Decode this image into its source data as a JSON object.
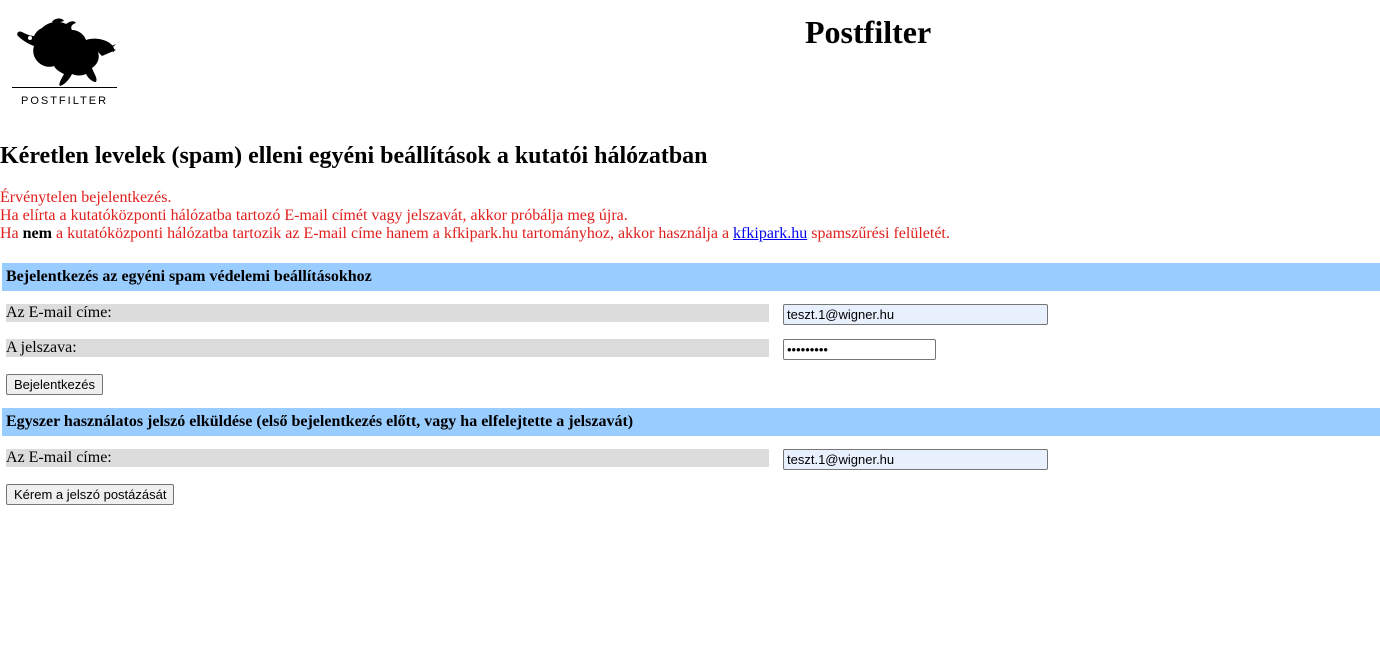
{
  "logo": {
    "text": "POSTFILTER"
  },
  "site_title": "Postfilter",
  "page_heading": "Kéretlen levelek (spam) elleni egyéni beállítások a kutatói hálózatban",
  "messages": {
    "line1": "Érvénytelen bejelentkezés.",
    "line2": "Ha elírta a kutatóközponti hálózatba tartozó E-mail címét vagy jelszavát, akkor próbálja meg újra.",
    "line3_prefix": "Ha ",
    "line3_bold": "nem",
    "line3_middle": " a kutatóközponti hálózatba tartozik az E-mail címe hanem a kfkipark.hu tartományhoz, akkor használja a ",
    "line3_link": "kfkipark.hu",
    "line3_suffix": " spamszűrési felületét.",
    "color": "#e0201e"
  },
  "login_section": {
    "title": "Bejelentkezés az egyéni spam védelemi beállításokhoz",
    "email_label": "Az E-mail címe:",
    "email_value": "teszt.1@wigner.hu",
    "password_label": "A jelszava:",
    "password_value": "123456789",
    "submit_label": "Bejelentkezés"
  },
  "otp_section": {
    "title": "Egyszer használatos jelszó elküldése (első bejelentkezés előtt, vagy ha elfelejtette a jelszavát)",
    "email_label": "Az E-mail címe:",
    "email_value": "teszt.1@wigner.hu",
    "submit_label": "Kérem a jelszó postázását"
  },
  "colors": {
    "section_bar": "#99ccff",
    "label_bg": "#dcdcdc",
    "autofill_bg": "#e8f0fe",
    "link": "#0000ee"
  }
}
